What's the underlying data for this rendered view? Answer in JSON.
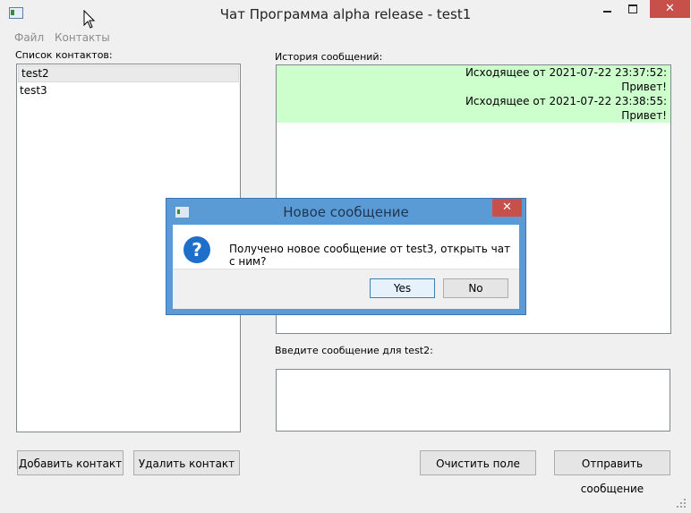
{
  "window": {
    "title": "Чат Программа alpha release - test1",
    "minimize_icon": "minimize-icon",
    "maximize_icon": "maximize-icon",
    "close_label": "✕"
  },
  "menu": {
    "items": [
      "Файл",
      "Контакты"
    ]
  },
  "contacts": {
    "label": "Список контактов:",
    "items": [
      "test2",
      "test3"
    ]
  },
  "history": {
    "label": "История сообщений:",
    "messages": [
      {
        "header": "Исходящее от 2021-07-22 23:37:52:",
        "text": "Привет!"
      },
      {
        "header": "Исходящее от 2021-07-22 23:38:55:",
        "text": "Привет!"
      }
    ]
  },
  "input": {
    "label": "Введите сообщение для test2:",
    "value": ""
  },
  "buttons": {
    "add_contact": "Добавить контакт",
    "remove_contact": "Удалить контакт",
    "clear": "Очистить поле",
    "send": "Отправить сообщение"
  },
  "dialog": {
    "title": "Новое сообщение",
    "icon": "question-icon",
    "message": "Получено новое сообщение от test3, открыть чат с ним?",
    "yes": "Yes",
    "no": "No",
    "close_label": "✕"
  },
  "colors": {
    "outgoing_message_bg": "#ccffcc",
    "dialog_frame": "#5b9bd5",
    "close_button": "#c7504b",
    "question_icon": "#1d6fc9"
  }
}
